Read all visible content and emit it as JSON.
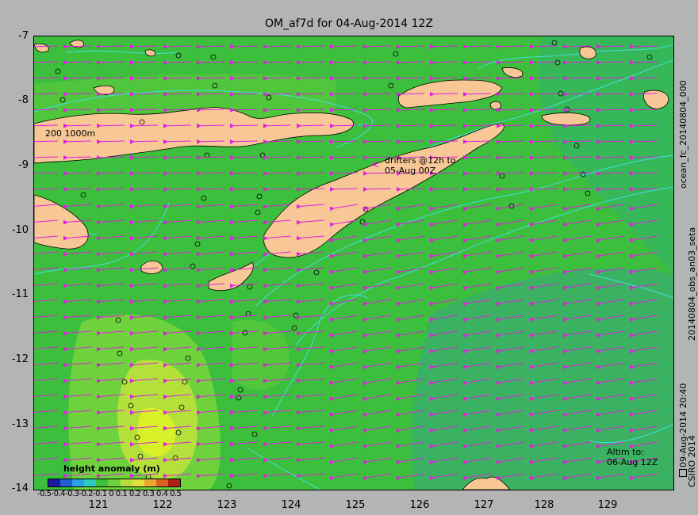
{
  "title": "OM_af7d for 04-Aug-2014 12Z",
  "y_ticks": [
    "-7",
    "-8",
    "-9",
    "-10",
    "-11",
    "-12",
    "-13",
    "-14"
  ],
  "x_ticks": [
    "121",
    "122",
    "123",
    "124",
    "125",
    "126",
    "127",
    "128",
    "129"
  ],
  "annotations": {
    "contours": "200  1000m",
    "drifters_line1": "drifters @12h to",
    "drifters_line2": "05-Aug 00Z",
    "altim_line1": "Altim to:",
    "altim_line2": "06-Aug 12Z",
    "drifter_symbol": "<"
  },
  "right_labels": {
    "forecast": "ocean_fc_20140804_000",
    "analysis": "09-Aug-2014 20:40",
    "obs": "20140804_obs_an03_seta",
    "copyright": "CSIRO 2014"
  },
  "legend": {
    "title": "height anomaly (m)",
    "ticks": "-0.5-0.4-0.3-0.2-0.1 0 0.1 0.2 0.3 0.4 0.5",
    "colors": [
      "#1a1aa0",
      "#1f5fd0",
      "#2aa0e0",
      "#30c8c0",
      "#3cbf3c",
      "#6ed23c",
      "#b4e03c",
      "#e0e03c",
      "#e8a830",
      "#d86020",
      "#b02010"
    ]
  },
  "colors": {
    "land": "#f7c896",
    "sea": "#3cbf3c",
    "arrows": "#e020e0",
    "contour": "#40e0e0",
    "frame": "#b4b4b4"
  }
}
